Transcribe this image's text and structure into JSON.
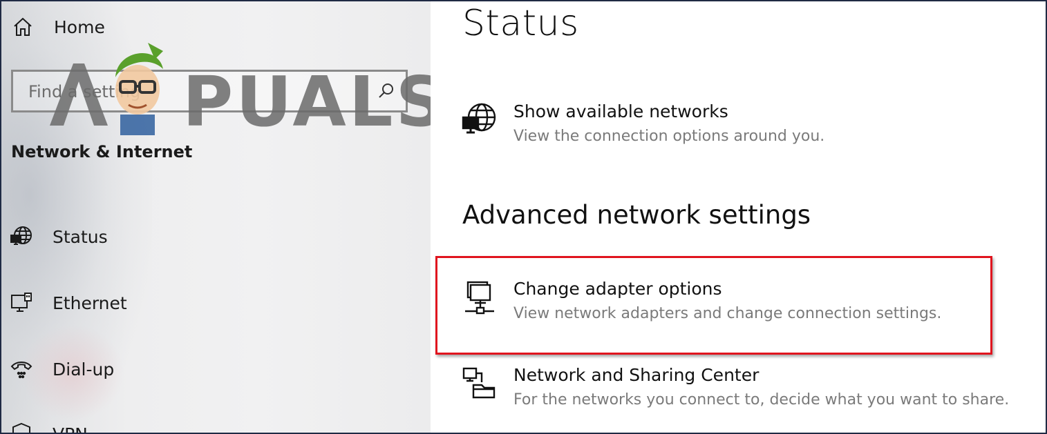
{
  "sidebar": {
    "home_label": "Home",
    "search_placeholder": "Find a setting",
    "section_title": "Network & Internet",
    "items": [
      {
        "label": "Status",
        "icon": "globe-monitor-icon"
      },
      {
        "label": "Ethernet",
        "icon": "ethernet-icon"
      },
      {
        "label": "Dial-up",
        "icon": "dialup-icon"
      },
      {
        "label": "VPN",
        "icon": "vpn-shield-icon"
      }
    ]
  },
  "watermark": {
    "text": "A PUALS"
  },
  "main": {
    "page_title": "Status",
    "show_networks": {
      "title": "Show available networks",
      "description": "View the connection options around you.",
      "icon": "globe-monitor-icon"
    },
    "advanced_heading": "Advanced network settings",
    "settings": [
      {
        "title": "Change adapter options",
        "description": "View network adapters and change connection settings.",
        "icon": "network-adapter-icon"
      },
      {
        "title": "Network and Sharing Center",
        "description": "For the networks you connect to, decide what you want to share.",
        "icon": "sharing-center-icon"
      }
    ]
  },
  "colors": {
    "highlight_border": "#e0141e",
    "description_text": "#7a7a7a",
    "frame_border": "#1f2a44"
  }
}
